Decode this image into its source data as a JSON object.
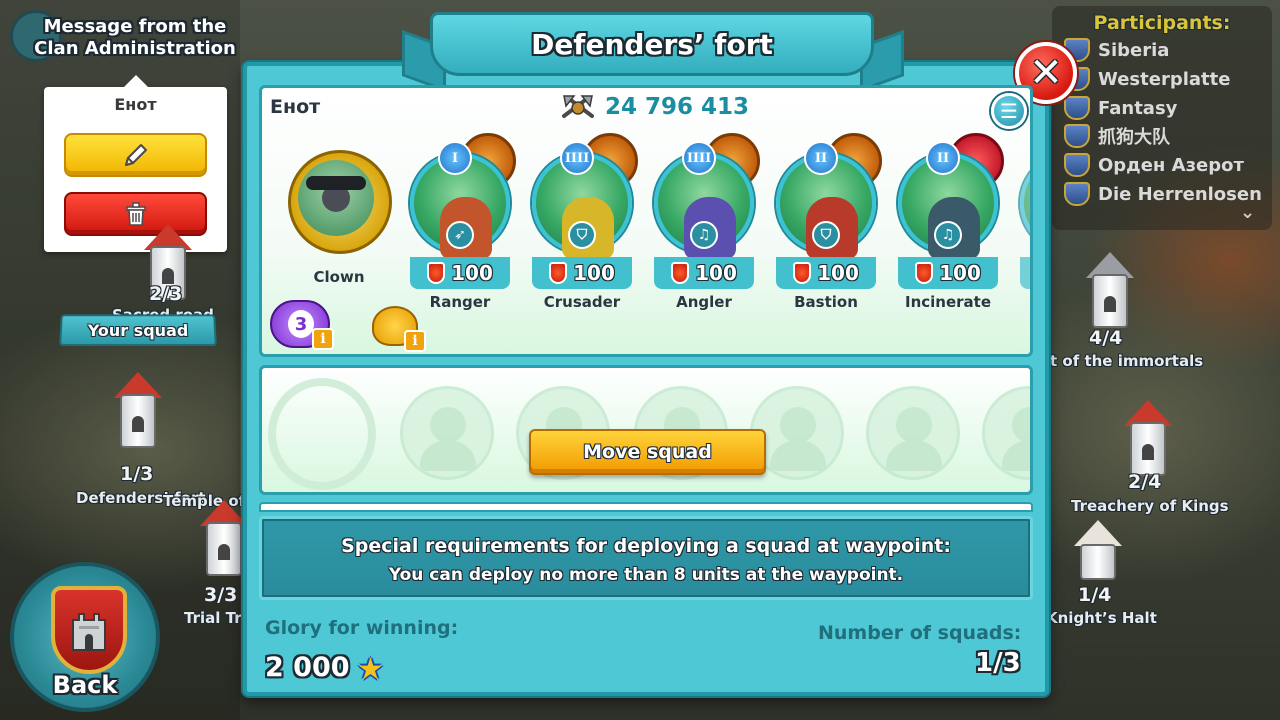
{
  "left": {
    "message_title_line1": "Message from the",
    "message_title_line2": "Clan Administration",
    "popup": {
      "name": "Енот"
    },
    "your_squad": "Your squad",
    "back": "Back",
    "map": [
      {
        "count": "2/3",
        "label": "Sacred road"
      },
      {
        "count": "1/3",
        "label": "Defenders’ fort"
      },
      {
        "count": "3/3",
        "label": "Trial Tr"
      }
    ],
    "temple_label": "Temple of"
  },
  "participants": {
    "title": "Participants:",
    "clans": [
      "Siberia",
      "Westerplatte",
      "Fantasy",
      "抓狗大队",
      "Орден Азерот",
      "Die Herrenlosen"
    ]
  },
  "right_map": [
    {
      "count": "4/4",
      "label": "t of the immortals"
    },
    {
      "count": "2/4",
      "label": "Treachery of Kings"
    },
    {
      "count": "1/4",
      "label": "Knight’s Halt"
    }
  ],
  "modal": {
    "title": "Defenders’ fort",
    "close_symbol": "✕",
    "squad": {
      "owner": "Енот",
      "power": "24 796 413",
      "leader": {
        "name": "Clown"
      },
      "heroes": [
        {
          "name": "Ranger",
          "rank": "I",
          "level": "100",
          "class_icon": "bow-icon",
          "skill_color": "#e27a15",
          "figure_color": "#c2552b"
        },
        {
          "name": "Crusader",
          "rank": "IIII",
          "level": "100",
          "class_icon": "shield-icon",
          "skill_color": "#e27a15",
          "figure_color": "#d8b62a"
        },
        {
          "name": "Angler",
          "rank": "IIII",
          "level": "100",
          "class_icon": "music-icon",
          "skill_color": "#e27a15",
          "figure_color": "#5b4fb0"
        },
        {
          "name": "Bastion",
          "rank": "II",
          "level": "100",
          "class_icon": "shield-icon",
          "skill_color": "#e27a15",
          "figure_color": "#b73a2a"
        },
        {
          "name": "Incinerate",
          "rank": "II",
          "level": "100",
          "class_icon": "music-icon",
          "skill_color": "#d8252f",
          "figure_color": "#3a5a6a"
        }
      ],
      "pet_level": "3",
      "info_symbol": "i"
    },
    "move_squad": "Move squad",
    "requirements": {
      "title": "Special requirements for deploying a squad at waypoint:",
      "text": "You can deploy no more than 8 units at the waypoint."
    },
    "glory_label": "Glory for winning:",
    "glory_value": "2 000",
    "squads_label": "Number of squads:",
    "squads_value": "1/3"
  },
  "colors": {
    "modal_bg": "#4fc8d6",
    "accent_teal": "#1a8ea0",
    "button_yellow": "#f1b400",
    "button_red": "#d0160e"
  }
}
